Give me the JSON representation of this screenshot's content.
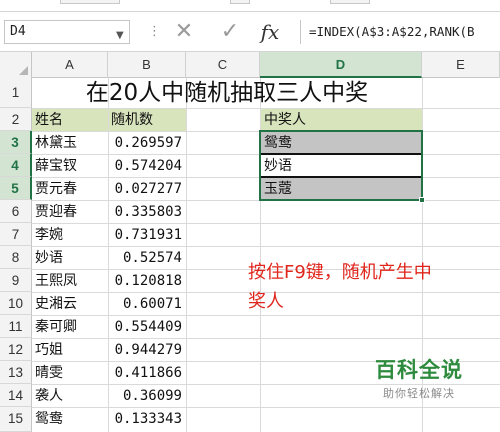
{
  "formula_bar": {
    "name_box": "D4",
    "formula": "=INDEX(A$3:A$22,RANK(B"
  },
  "icons": {
    "cancel": "close-icon",
    "enter": "check-icon",
    "function": "fx-icon",
    "name_box_dropdown": "chevron-down-icon",
    "select_all": "select-all-triangle"
  },
  "columns": [
    "A",
    "B",
    "C",
    "D",
    "E"
  ],
  "selected_column": "D",
  "rows": [
    "1",
    "2",
    "3",
    "4",
    "5",
    "6",
    "7",
    "8",
    "9",
    "10",
    "11",
    "12",
    "13",
    "14",
    "15"
  ],
  "selected_rows": [
    "3",
    "4",
    "5"
  ],
  "sheet": {
    "title": "在20人中随机抽取三人中奖",
    "header_name": "姓名",
    "header_random": "随机数",
    "header_winners": "中奖人",
    "people": [
      {
        "name": "林黛玉",
        "random": "0.269597"
      },
      {
        "name": "薛宝钗",
        "random": "0.574204"
      },
      {
        "name": "贾元春",
        "random": "0.027277"
      },
      {
        "name": "贾迎春",
        "random": "0.335803"
      },
      {
        "name": "李婉",
        "random": "0.731931"
      },
      {
        "name": "妙语",
        "random": "0.52574"
      },
      {
        "name": "王熙凤",
        "random": "0.120818"
      },
      {
        "name": "史湘云",
        "random": "0.60071"
      },
      {
        "name": "秦可卿",
        "random": "0.554409"
      },
      {
        "name": "巧姐",
        "random": "0.944279"
      },
      {
        "name": "晴雯",
        "random": "0.411866"
      },
      {
        "name": "袭人",
        "random": "0.36099"
      },
      {
        "name": "鸳鸯",
        "random": "0.133343"
      }
    ],
    "winners": [
      "鸳鸯",
      "妙语",
      "玉蔻"
    ]
  },
  "annotation": {
    "line1": "按住F9键，随机产生中",
    "line2": "奖人"
  },
  "watermark": {
    "title": "百科全说",
    "subtitle": "助你轻松解决"
  },
  "colors": {
    "excel_green": "#217346",
    "header_fill": "#d8e4bc",
    "winner_fill": "#c4c4c4",
    "annotation": "#e0261c",
    "watermark": "#2e8b3e"
  }
}
